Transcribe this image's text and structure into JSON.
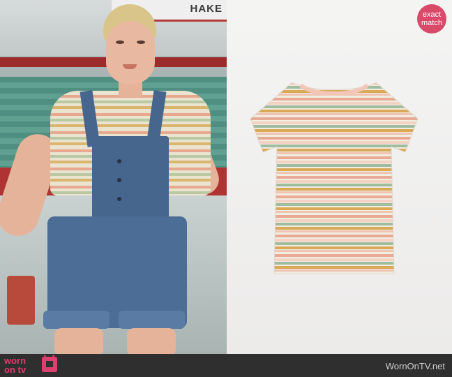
{
  "left_photo": {
    "sign_text": "HAKE"
  },
  "badge": {
    "line1": "exact",
    "line2": "match",
    "color": "#d94a6a"
  },
  "footer": {
    "logo_line1": "worn",
    "logo_line2": "on tv",
    "site": "WornOnTV.net",
    "brand_color": "#e23d6f"
  },
  "shirt": {
    "stripe_colors": [
      "#f1ede0",
      "#e8a995",
      "#f1ede0",
      "#9fbba0",
      "#f1ede0",
      "#d9a957",
      "#f3d2c4"
    ]
  }
}
